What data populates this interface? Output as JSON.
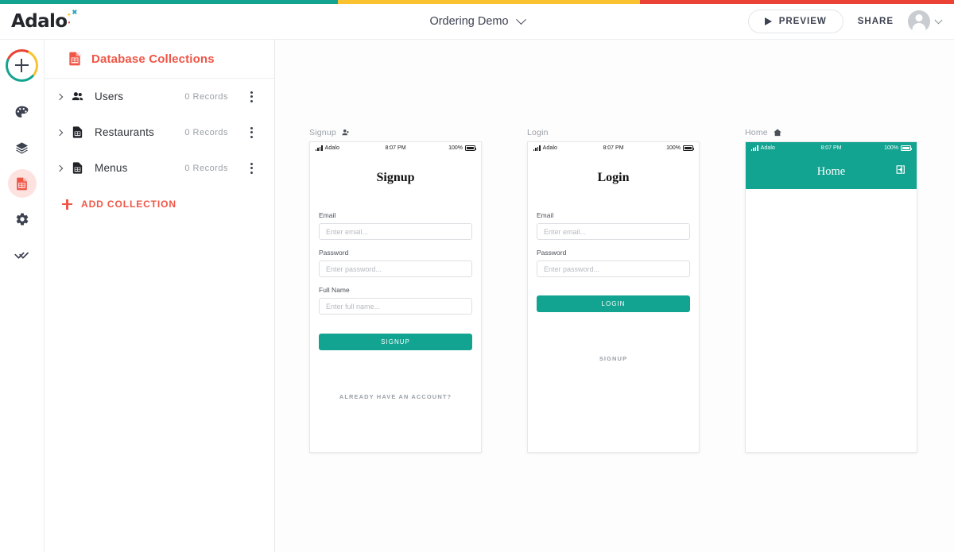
{
  "accent_colors": {
    "teal": "#13a391",
    "yellow": "#f9c22e",
    "red": "#ea4335"
  },
  "header": {
    "logo_text": "Adalo",
    "project_name": "Ordering Demo",
    "dropdown_icon": "chevron-down-icon",
    "preview_label": "PREVIEW",
    "share_label": "SHARE",
    "avatar_icon": "user-avatar-icon",
    "avatar_chevron_icon": "chevron-down-icon"
  },
  "rail": {
    "add_button_icon": "plus-icon",
    "items": [
      {
        "icon": "palette-icon",
        "name": "design",
        "active": false
      },
      {
        "icon": "layers-icon",
        "name": "screens",
        "active": false
      },
      {
        "icon": "database-icon",
        "name": "database",
        "active": true
      },
      {
        "icon": "gear-icon",
        "name": "settings",
        "active": false
      },
      {
        "icon": "double-check-icon",
        "name": "publish",
        "active": false
      }
    ]
  },
  "panel": {
    "title": "Database Collections",
    "title_icon": "database-icon",
    "collections": [
      {
        "name": "Users",
        "records": "0 Records",
        "icon": "users-icon",
        "expand_icon": "chevron-right-icon",
        "menu_icon": "kebab-menu-icon"
      },
      {
        "name": "Restaurants",
        "records": "0 Records",
        "icon": "table-doc-icon",
        "expand_icon": "chevron-right-icon",
        "menu_icon": "kebab-menu-icon"
      },
      {
        "name": "Menus",
        "records": "0 Records",
        "icon": "table-doc-icon",
        "expand_icon": "chevron-right-icon",
        "menu_icon": "kebab-menu-icon"
      }
    ],
    "add_collection_label": "ADD COLLECTION",
    "add_collection_icon": "plus-icon"
  },
  "canvas": {
    "screens": [
      {
        "label": "Signup",
        "label_icon": "person-add-icon",
        "status": {
          "carrier": "Adalo",
          "time": "8:07 PM",
          "battery": "100%",
          "signal_icon": "signal-bars-icon",
          "battery_icon": "battery-full-icon"
        },
        "title": "Signup",
        "fields": [
          {
            "label": "Email",
            "placeholder": "Enter email..."
          },
          {
            "label": "Password",
            "placeholder": "Enter password..."
          },
          {
            "label": "Full Name",
            "placeholder": "Enter full name..."
          }
        ],
        "button": "SIGNUP",
        "link": "ALREADY HAVE AN ACCOUNT?"
      },
      {
        "label": "Login",
        "label_icon": "",
        "status": {
          "carrier": "Adalo",
          "time": "8:07 PM",
          "battery": "100%",
          "signal_icon": "signal-bars-icon",
          "battery_icon": "battery-full-icon"
        },
        "title": "Login",
        "fields": [
          {
            "label": "Email",
            "placeholder": "Enter email..."
          },
          {
            "label": "Password",
            "placeholder": "Enter password..."
          }
        ],
        "button": "LOGIN",
        "link": "SIGNUP"
      },
      {
        "label": "Home",
        "label_icon": "home-icon",
        "status": {
          "carrier": "Adalo",
          "time": "8:07 PM",
          "battery": "100%",
          "signal_icon": "signal-bars-icon",
          "battery_icon": "battery-full-icon"
        },
        "title": "Home",
        "logout_icon": "logout-icon"
      }
    ]
  }
}
